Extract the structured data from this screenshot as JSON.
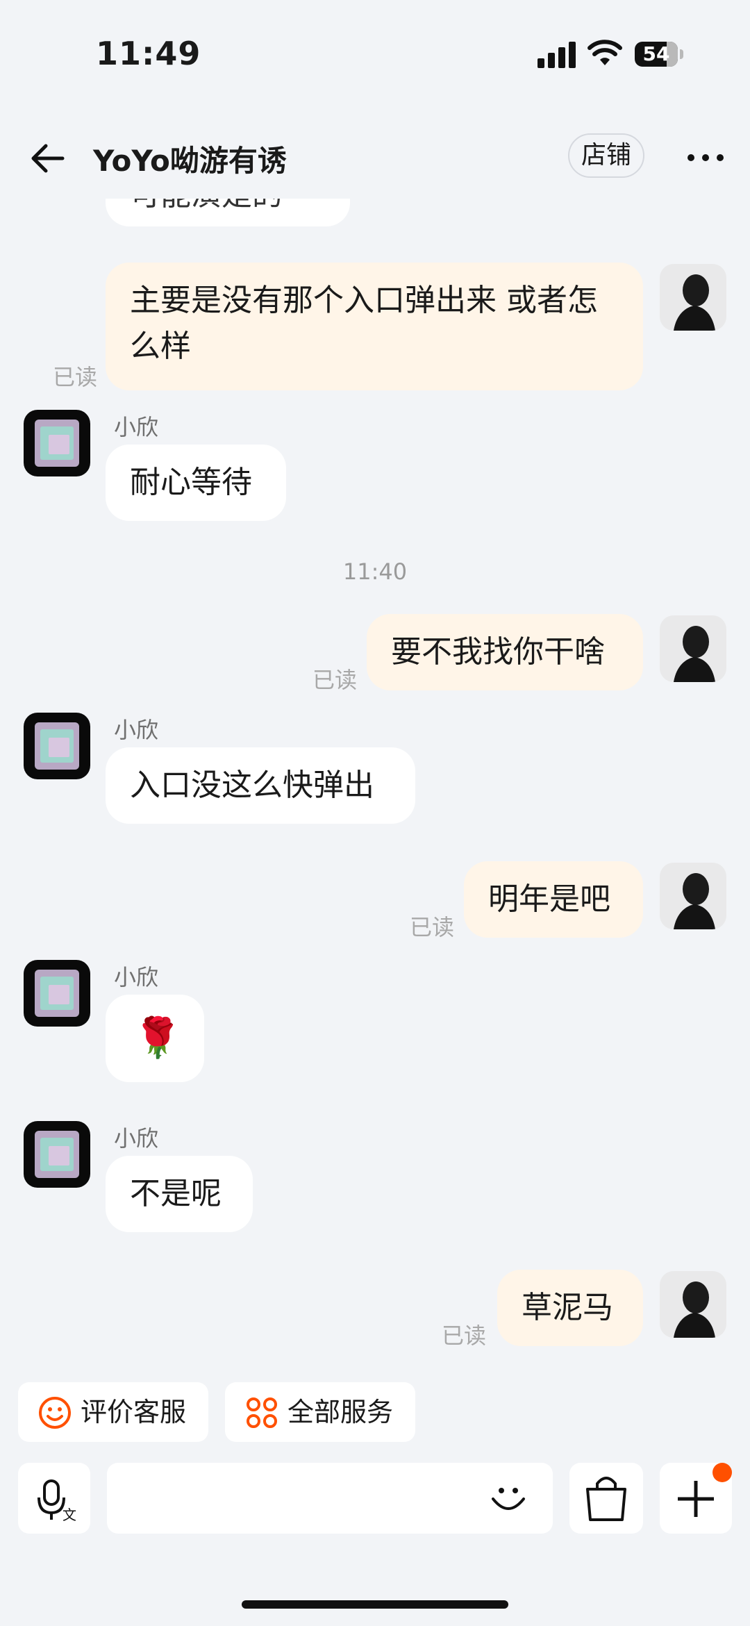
{
  "status_bar": {
    "time": "11:49",
    "battery_level": "54"
  },
  "header": {
    "title": "YoYo呦游有诱",
    "shop_button": "店铺"
  },
  "messages": {
    "m0_text": "可能演是的",
    "m1_text": "主要是没有那个入口弹出来 或者怎么样",
    "m1_read": "已读",
    "m2_sender": "小欣",
    "m2_text": "耐心等待",
    "time_divider": "11:40",
    "m3_text": "要不我找你干啥",
    "m3_read": "已读",
    "m4_sender": "小欣",
    "m4_text": "入口没这么快弹出",
    "m5_text": "明年是吧",
    "m5_read": "已读",
    "m6_sender": "小欣",
    "m6_emoji": "🌹",
    "m7_sender": "小欣",
    "m7_text": "不是呢",
    "m8_text": "草泥马",
    "m8_read": "已读"
  },
  "quick_actions": {
    "rate_service": "评价客服",
    "all_services": "全部服务"
  },
  "input_bar": {
    "placeholder": ""
  },
  "colors": {
    "accent": "#ff5000",
    "outgoing_bubble": "#fff5e8",
    "incoming_bubble": "#ffffff",
    "background": "#f2f4f7"
  }
}
